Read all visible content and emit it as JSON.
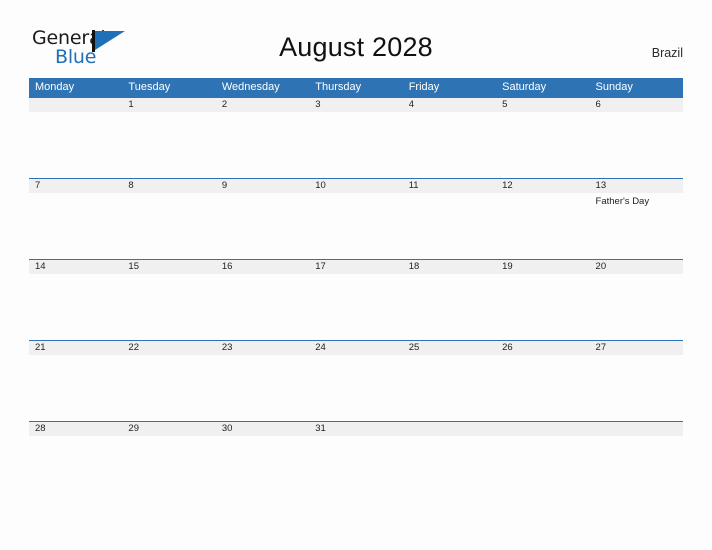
{
  "brand": {
    "name_part1": "General",
    "name_part2": "Blue",
    "accent_color": "#2070b8",
    "flag_icon": "flag-triangle-icon"
  },
  "header": {
    "title": "August 2028",
    "region": "Brazil"
  },
  "calendar": {
    "header_bg": "#2e74b5",
    "date_row_bg": "#f0f0f0",
    "day_names": [
      "Monday",
      "Tuesday",
      "Wednesday",
      "Thursday",
      "Friday",
      "Saturday",
      "Sunday"
    ],
    "weeks": [
      {
        "days": [
          {
            "date": "",
            "events": []
          },
          {
            "date": "1",
            "events": []
          },
          {
            "date": "2",
            "events": []
          },
          {
            "date": "3",
            "events": []
          },
          {
            "date": "4",
            "events": []
          },
          {
            "date": "5",
            "events": []
          },
          {
            "date": "6",
            "events": []
          }
        ]
      },
      {
        "days": [
          {
            "date": "7",
            "events": []
          },
          {
            "date": "8",
            "events": []
          },
          {
            "date": "9",
            "events": []
          },
          {
            "date": "10",
            "events": []
          },
          {
            "date": "11",
            "events": []
          },
          {
            "date": "12",
            "events": []
          },
          {
            "date": "13",
            "events": [
              "Father's Day"
            ]
          }
        ]
      },
      {
        "days": [
          {
            "date": "14",
            "events": []
          },
          {
            "date": "15",
            "events": []
          },
          {
            "date": "16",
            "events": []
          },
          {
            "date": "17",
            "events": []
          },
          {
            "date": "18",
            "events": []
          },
          {
            "date": "19",
            "events": []
          },
          {
            "date": "20",
            "events": []
          }
        ]
      },
      {
        "days": [
          {
            "date": "21",
            "events": []
          },
          {
            "date": "22",
            "events": []
          },
          {
            "date": "23",
            "events": []
          },
          {
            "date": "24",
            "events": []
          },
          {
            "date": "25",
            "events": []
          },
          {
            "date": "26",
            "events": []
          },
          {
            "date": "27",
            "events": []
          }
        ]
      },
      {
        "days": [
          {
            "date": "28",
            "events": []
          },
          {
            "date": "29",
            "events": []
          },
          {
            "date": "30",
            "events": []
          },
          {
            "date": "31",
            "events": []
          },
          {
            "date": "",
            "events": []
          },
          {
            "date": "",
            "events": []
          },
          {
            "date": "",
            "events": []
          }
        ]
      }
    ]
  }
}
